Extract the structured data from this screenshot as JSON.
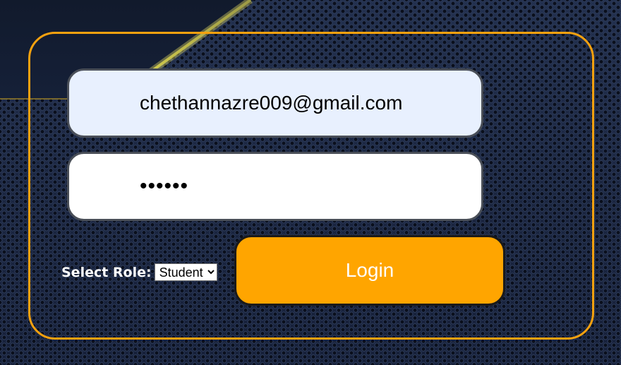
{
  "login_form": {
    "email_value": "chethannazre009@gmail.com",
    "password_value": "••••••",
    "role_label": "Select Role:",
    "role_selected": "Student",
    "role_options": [
      "Student"
    ],
    "login_label": "Login"
  },
  "icons": {
    "role_dropdown_arrow": "chevron-down-icon"
  },
  "colors": {
    "accent": "#ffa500",
    "frame_border": "#f5a10f",
    "email_field_bg": "#e8f0fe",
    "streak": "#e8e040",
    "background": "#1b2640"
  }
}
